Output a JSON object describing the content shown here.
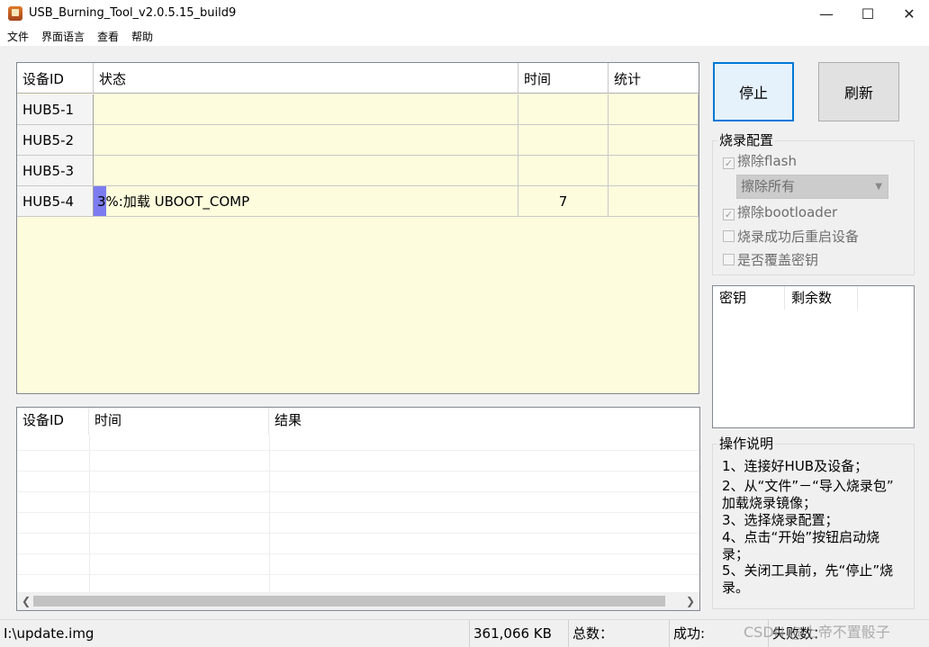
{
  "window": {
    "title": "USB_Burning_Tool_v2.0.5.15_build9",
    "minimize": "—",
    "maximize": "☐",
    "close": "✕"
  },
  "menu": [
    "文件",
    "界面语言",
    "查看",
    "帮助"
  ],
  "device_table": {
    "columns": [
      "设备ID",
      "状态",
      "时间",
      "统计"
    ],
    "rows": [
      {
        "id": "HUB5-1",
        "status": "",
        "time": "",
        "stat": ""
      },
      {
        "id": "HUB5-2",
        "status": "",
        "time": "",
        "stat": ""
      },
      {
        "id": "HUB5-3",
        "status": "",
        "time": "",
        "stat": ""
      },
      {
        "id": "HUB5-4",
        "status": "3%:加载 UBOOT_COMP",
        "time": "7",
        "stat": "",
        "progress_percent": 3
      }
    ]
  },
  "result_table": {
    "columns": [
      "设备ID",
      "时间",
      "结果"
    ]
  },
  "buttons": {
    "stop": "停止",
    "refresh": "刷新"
  },
  "burn_config": {
    "title": "烧录配置",
    "erase_flash": {
      "label": "擦除flash",
      "checked": true
    },
    "erase_mode": "擦除所有",
    "erase_bootloader": {
      "label": "擦除bootloader",
      "checked": true
    },
    "reset_after_success": {
      "label": "烧录成功后重启设备",
      "checked": false
    },
    "overwrite_key": {
      "label": "是否覆盖密钥",
      "checked": false
    }
  },
  "key_table": {
    "columns": [
      "密钥",
      "剩余数"
    ]
  },
  "instructions": {
    "title": "操作说明",
    "lines": [
      "1、连接好HUB及设备；",
      "2、从“文件”－“导入烧录包”",
      "加载烧录镜像；",
      "3、选择烧录配置；",
      "4、点击“开始”按钮启动烧",
      "录；",
      "5、关闭工具前，先“停止”烧",
      "录。"
    ]
  },
  "status_bar": {
    "image_path": "I:\\update.img",
    "image_size": "361,066 KB",
    "total_label": "总数：",
    "success_label": "成功:",
    "fail_label": "失败数：",
    "watermark": "CSDN @上帝不置骰子"
  },
  "colors": {
    "device_table_bg": "#fdfcdd",
    "progress_fill": "#7c7cf0",
    "focus_border": "#0078d7"
  }
}
